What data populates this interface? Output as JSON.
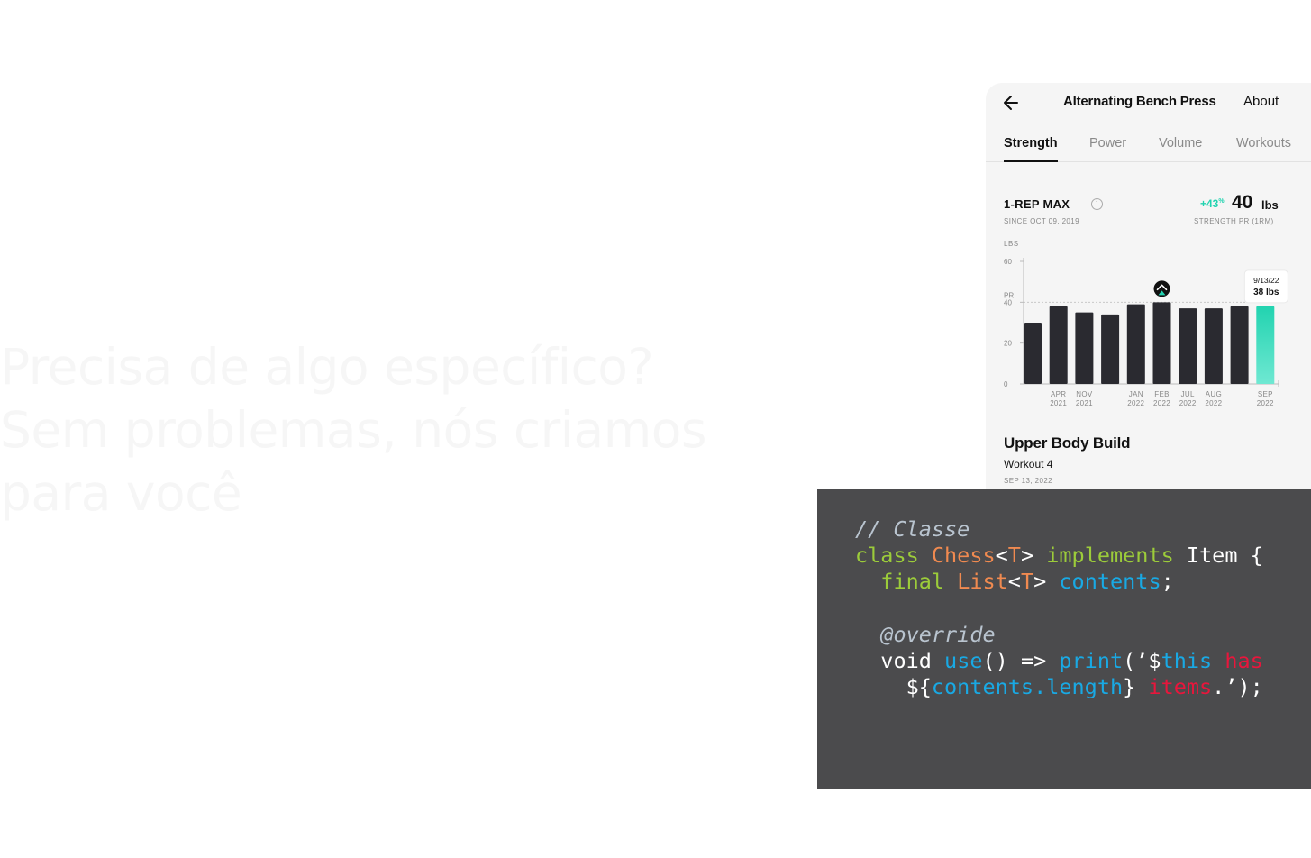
{
  "hero": {
    "lines": [
      "Precisa de algo específico?",
      "Sem problemas, nós criamos",
      "para você"
    ]
  },
  "app": {
    "title": "Alternating Bench Press",
    "about": "About",
    "tabs": [
      {
        "label": "Strength",
        "active": true
      },
      {
        "label": "Power",
        "active": false
      },
      {
        "label": "Volume",
        "active": false
      },
      {
        "label": "Workouts",
        "active": false
      }
    ],
    "one_rep_max": {
      "label": "1-REP MAX",
      "since": "SINCE OCT 09, 2019",
      "change": "+43",
      "change_unit": "%",
      "value": "40",
      "unit": "lbs",
      "value_label": "STRENGTH PR (1RM)"
    },
    "workout": {
      "title": "Upper Body Build",
      "subtitle": "Workout 4",
      "date": "SEP 13, 2022"
    }
  },
  "chart_data": {
    "type": "bar",
    "ylabel": "LBS",
    "ylim": [
      0,
      60
    ],
    "yticks": [
      "0",
      "20",
      "40",
      "60"
    ],
    "pr_label": "PR",
    "pr_value": 40,
    "values": [
      30,
      38,
      35,
      34,
      39,
      40,
      37,
      37,
      38,
      38
    ],
    "x_labels": [
      {
        "index": 1,
        "month": "APR",
        "year": "2021"
      },
      {
        "index": 2,
        "month": "NOV",
        "year": "2021"
      },
      {
        "index": 4,
        "month": "JAN",
        "year": "2022"
      },
      {
        "index": 5,
        "month": "FEB",
        "year": "2022"
      },
      {
        "index": 6,
        "month": "JUL",
        "year": "2022"
      },
      {
        "index": 7,
        "month": "AUG",
        "year": "2022"
      },
      {
        "index": 9,
        "month": "SEP",
        "year": "2022"
      }
    ],
    "highlight_index": 9,
    "pr_marker_index": 5,
    "tooltip": {
      "date": "9/13/22",
      "value": "38 lbs"
    },
    "colors": {
      "bar": "#2a2a30",
      "highlight": "#22d3b0",
      "axis": "#bbbbbb"
    }
  },
  "code": {
    "language": "dart",
    "lines": [
      [
        {
          "t": "// Classe",
          "c": "com"
        }
      ],
      [
        {
          "t": "class ",
          "c": "kw"
        },
        {
          "t": "Chess",
          "c": "type"
        },
        {
          "t": "<",
          "c": "plain"
        },
        {
          "t": "T",
          "c": "type"
        },
        {
          "t": "> ",
          "c": "plain"
        },
        {
          "t": "implements",
          "c": "kw"
        },
        {
          "t": " Item {",
          "c": "plain"
        }
      ],
      [
        {
          "t": "  ",
          "c": "plain"
        },
        {
          "t": "final",
          "c": "kw"
        },
        {
          "t": " ",
          "c": "plain"
        },
        {
          "t": "List",
          "c": "type"
        },
        {
          "t": "<",
          "c": "plain"
        },
        {
          "t": "T",
          "c": "type"
        },
        {
          "t": "> ",
          "c": "plain"
        },
        {
          "t": "contents",
          "c": "id"
        },
        {
          "t": ";",
          "c": "plain"
        }
      ],
      [],
      [
        {
          "t": "  @override",
          "c": "com"
        }
      ],
      [
        {
          "t": "  void ",
          "c": "plain"
        },
        {
          "t": "use",
          "c": "id"
        },
        {
          "t": "() => ",
          "c": "plain"
        },
        {
          "t": "print",
          "c": "id"
        },
        {
          "t": "(’$",
          "c": "plain"
        },
        {
          "t": "this",
          "c": "id"
        },
        {
          "t": " has",
          "c": "str"
        }
      ],
      [
        {
          "t": "    ${",
          "c": "plain"
        },
        {
          "t": "contents.length",
          "c": "id"
        },
        {
          "t": "} ",
          "c": "plain"
        },
        {
          "t": "items",
          "c": "str"
        },
        {
          "t": ".’);",
          "c": "plain"
        }
      ]
    ]
  }
}
